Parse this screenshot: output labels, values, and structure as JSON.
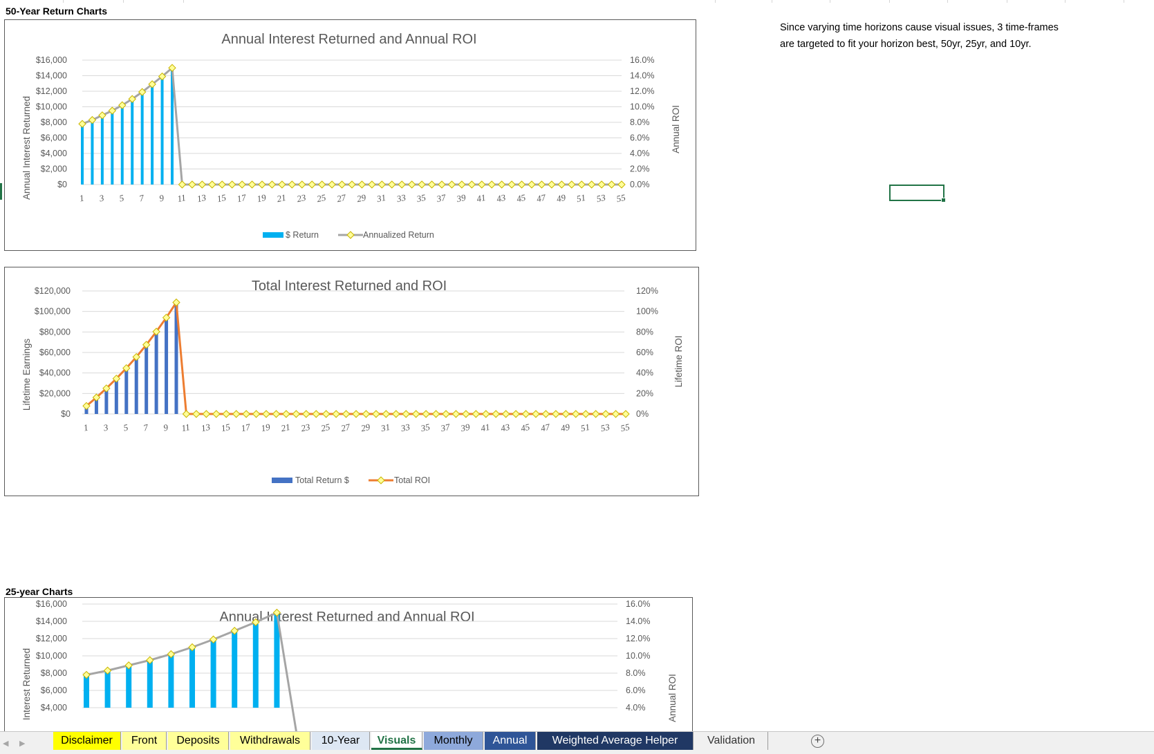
{
  "sheet": {
    "title_50yr": "50-Year Return Charts",
    "title_25yr": "25-year Charts",
    "note_line1": "Since varying time horizons cause visual issues, 3 time-frames",
    "note_line2": "are targeted to fit your horizon best, 50yr, 25yr, and 10yr."
  },
  "colors": {
    "bar_blue": "#00b0f0",
    "bar_darkblue": "#4472c4",
    "line_gray": "#a5a5a5",
    "line_orange": "#ed7d31",
    "marker_fill": "#ffff99",
    "marker_stroke": "#c9b400",
    "grid": "#d9d9d9",
    "accent_green": "#217346"
  },
  "chart_data": [
    {
      "id": "c50a",
      "type": "bar",
      "title": "Annual Interest Returned and Annual ROI",
      "ylabel": "Annual Interest Returned",
      "y2label": "Annual ROI",
      "ylim": [
        0,
        16000
      ],
      "y2lim": [
        0,
        0.16
      ],
      "yticks": [
        "$16,000",
        "$14,000",
        "$12,000",
        "$10,000",
        "$8,000",
        "$6,000",
        "$4,000",
        "$2,000",
        "$0"
      ],
      "y2ticks": [
        "16.0%",
        "14.0%",
        "12.0%",
        "10.0%",
        "8.0%",
        "6.0%",
        "4.0%",
        "2.0%",
        "0.0%"
      ],
      "xtick_labels": [
        "1",
        "3",
        "5",
        "7",
        "9",
        "11",
        "13",
        "15",
        "17",
        "19",
        "21",
        "23",
        "25",
        "27",
        "29",
        "31",
        "33",
        "35",
        "37",
        "39",
        "41",
        "43",
        "45",
        "47",
        "49",
        "51",
        "53",
        "55"
      ],
      "n_points": 55,
      "series": [
        {
          "name": "$ Return",
          "kind": "bar",
          "values": [
            7800,
            8300,
            8900,
            9500,
            10200,
            10900,
            11900,
            12800,
            13700,
            14800
          ]
        },
        {
          "name": "Annualized Return",
          "kind": "line",
          "axis": "secondary",
          "values": [
            0.078,
            0.083,
            0.089,
            0.095,
            0.102,
            0.11,
            0.119,
            0.129,
            0.139,
            0.15
          ]
        }
      ]
    },
    {
      "id": "c50b",
      "type": "bar",
      "title": "Total Interest Returned and ROI",
      "ylabel": "Lifetime Earnings",
      "y2label": "Lifetime ROI",
      "ylim": [
        0,
        120000
      ],
      "y2lim": [
        0,
        1.2
      ],
      "yticks": [
        "$120,000",
        "$100,000",
        "$80,000",
        "$60,000",
        "$40,000",
        "$20,000",
        "$0"
      ],
      "y2ticks": [
        "120%",
        "100%",
        "80%",
        "60%",
        "40%",
        "20%",
        "0%"
      ],
      "xtick_labels": [
        "1",
        "3",
        "5",
        "7",
        "9",
        "11",
        "13",
        "15",
        "17",
        "19",
        "21",
        "23",
        "25",
        "27",
        "29",
        "31",
        "33",
        "35",
        "37",
        "39",
        "41",
        "43",
        "45",
        "47",
        "49",
        "51",
        "53",
        "55"
      ],
      "n_points": 55,
      "series": [
        {
          "name": "Total Return $",
          "kind": "bar",
          "values": [
            7800,
            16100,
            25000,
            34500,
            44700,
            55600,
            67500,
            80300,
            94000,
            108800
          ]
        },
        {
          "name": "Total ROI",
          "kind": "line",
          "axis": "secondary",
          "values": [
            0.078,
            0.161,
            0.25,
            0.345,
            0.447,
            0.556,
            0.675,
            0.803,
            0.94,
            1.088
          ]
        }
      ]
    },
    {
      "id": "c25a",
      "type": "bar",
      "title": "Annual Interest Returned and Annual ROI",
      "ylabel": "Interest Returned",
      "y2label": "Annual ROI",
      "ylim": [
        0,
        16000
      ],
      "y2lim": [
        0,
        0.16
      ],
      "yticks": [
        "$16,000",
        "$14,000",
        "$12,000",
        "$10,000",
        "$8,000",
        "$6,000",
        "$4,000"
      ],
      "y2ticks": [
        "16.0%",
        "14.0%",
        "12.0%",
        "10.0%",
        "8.0%",
        "6.0%",
        "4.0%"
      ],
      "n_points": 25,
      "series": [
        {
          "name": "$ Return",
          "kind": "bar",
          "values": [
            7800,
            8300,
            8900,
            9500,
            10200,
            10900,
            11900,
            12800,
            13700,
            14800
          ]
        },
        {
          "name": "Annualized Return",
          "kind": "line",
          "axis": "secondary",
          "values": [
            0.078,
            0.083,
            0.089,
            0.095,
            0.102,
            0.11,
            0.119,
            0.129,
            0.139,
            0.15
          ]
        }
      ]
    }
  ],
  "tabs": [
    {
      "label": "Disclaimer",
      "bg": "#ffff00",
      "fg": "#000000"
    },
    {
      "label": "Front",
      "bg": "#ffff99",
      "fg": "#000000"
    },
    {
      "label": "Deposits",
      "bg": "#ffff99",
      "fg": "#000000"
    },
    {
      "label": "Withdrawals",
      "bg": "#ffff99",
      "fg": "#000000"
    },
    {
      "label": "10-Year",
      "bg": "#dde7f3",
      "fg": "#000000"
    },
    {
      "label": "Visuals",
      "bg": "#ffffff",
      "fg": "#217346",
      "active": true
    },
    {
      "label": "Monthly",
      "bg": "#8ea9db",
      "fg": "#000000"
    },
    {
      "label": "Annual",
      "bg": "#2f5597",
      "fg": "#ffffff"
    },
    {
      "label": "Weighted Average Helper",
      "bg": "#203864",
      "fg": "#ffffff"
    },
    {
      "label": "Validation",
      "bg": "#f0f0f0",
      "fg": "#333333"
    }
  ],
  "add_sheet_symbol": "+"
}
